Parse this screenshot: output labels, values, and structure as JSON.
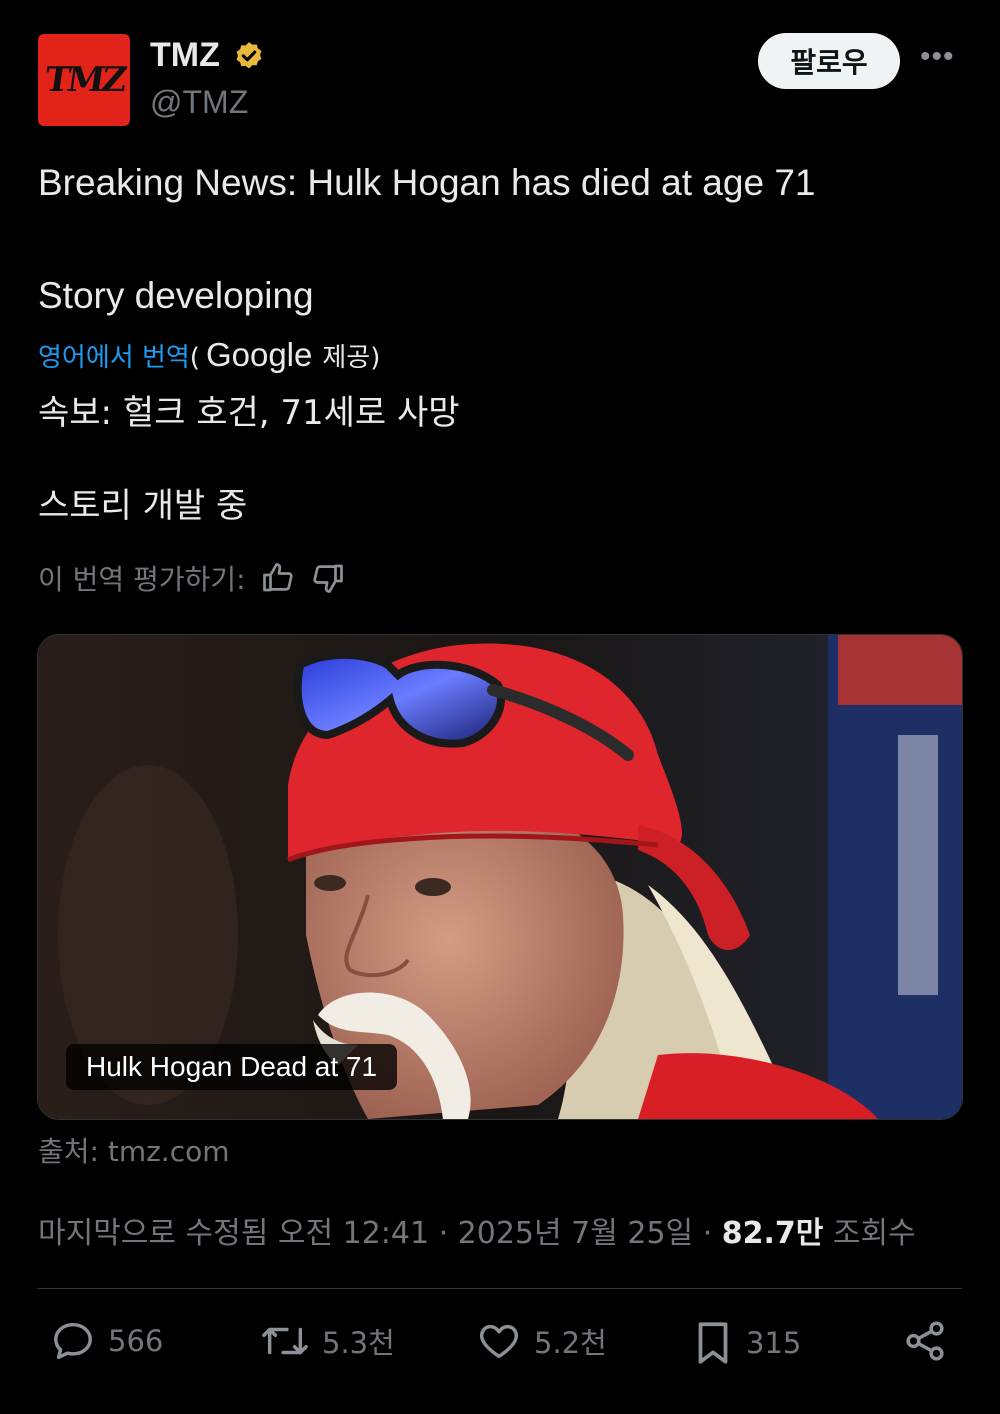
{
  "account": {
    "avatar_text": "TMZ",
    "name": "TMZ",
    "handle": "@TMZ",
    "follow_label": "팔로우",
    "more_label": "•••"
  },
  "post": {
    "text_line1": "Breaking News: Hulk Hogan has died at age 71",
    "text_line2": "Story developing"
  },
  "translation": {
    "link": "영어에서 번역",
    "open_paren": "(",
    "google": "Google",
    "provided": "제공)",
    "line1": "속보: 헐크 호건, 71세로 사망",
    "line2": "스토리 개발 중",
    "rate_label": "이 번역 평가하기:"
  },
  "media": {
    "caption": "Hulk Hogan Dead at 71",
    "source": "출처: tmz.com"
  },
  "meta": {
    "edited": "마지막으로 수정됨 오전 12:41 · 2025년 7월 25일 · ",
    "views_count": "82.7만",
    "views_label": " 조회수"
  },
  "actions": {
    "replies": "566",
    "reposts": "5.3천",
    "likes": "5.2천",
    "bookmarks": "315"
  },
  "colors": {
    "background": "#000000",
    "accent_link": "#1d9bf0",
    "verified_badge": "#e8b93c",
    "avatar_red": "#e2231a"
  }
}
